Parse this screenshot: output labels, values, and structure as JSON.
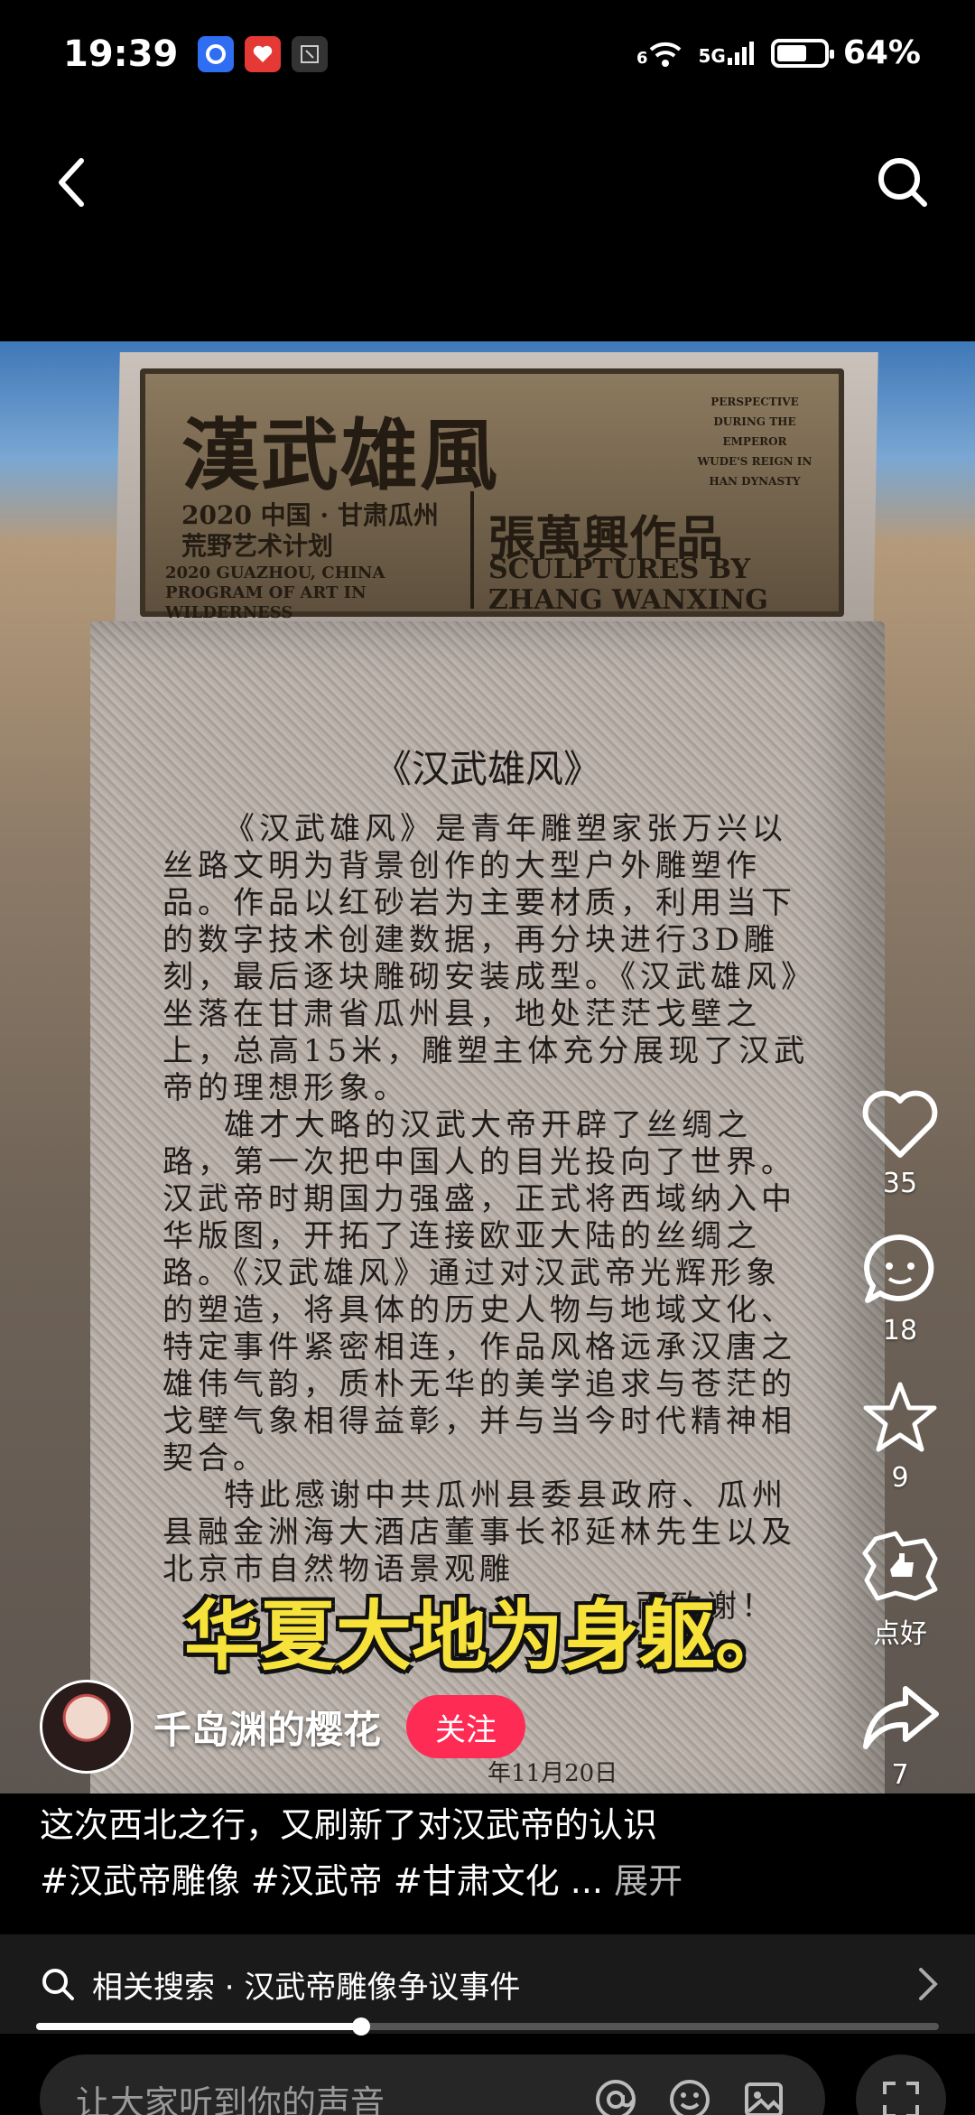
{
  "status_bar": {
    "time": "19:39",
    "network_left": "6",
    "network_right": "5G",
    "battery_percent": 64,
    "battery_label": "64%",
    "app_badges": [
      "app-badge-blue-icon",
      "app-badge-red-icon",
      "app-badge-gray-icon"
    ]
  },
  "nav": {
    "back_icon": "chevron-left-icon",
    "search_icon": "search-icon"
  },
  "media": {
    "plaque": {
      "title": "漢武雄風",
      "side_en": "PERSPECTIVE DURING THE EMPEROR WUDE'S REIGN IN HAN DYNASTY",
      "cn_left_line1": "2020 中国 · 甘肃瓜州",
      "cn_left_line2": "荒野艺术计划",
      "en_left": "2020 GUAZHOU, CHINA PROGRAM OF ART IN WILDERNESS",
      "cn_right": "張萬興作品",
      "en_right": "SCULPTURES BY ZHANG WANXING"
    },
    "stone_heading": "《汉武雄风》",
    "stone_paragraphs": [
      "《汉武雄风》是青年雕塑家张万兴以丝路文明为背景创作的大型户外雕塑作品。作品以红砂岩为主要材质，利用当下的数字技术创建数据，再分块进行3D雕刻，最后逐块雕砌安装成型。《汉武雄风》坐落在甘肃省瓜州县，地处茫茫戈壁之上，总高15米，雕塑主体充分展现了汉武帝的理想形象。",
      "雄才大略的汉武大帝开辟了丝绸之路，第一次把中国人的目光投向了世界。汉武帝时期国力强盛，正式将西域纳入中华版图，开拓了连接欧亚大陆的丝绸之路。《汉武雄风》通过对汉武帝光辉形象的塑造，将具体的历史人物与地域文化、特定事件紧密相连，作品风格远承汉唐之雄伟气韵，质朴无华的美学追求与苍茫的戈壁气象相得益彰，并与当今时代精神相契合。",
      "特此感谢中共瓜州县委县政府、瓜州县融金洲海大酒店董事长祁延林先生以及北京市自然物语景观雕"
    ],
    "stone_footer": "而致谢！",
    "stone_date": "年11月20日",
    "caption": "华夏大地为身躯。"
  },
  "author": {
    "name": "千岛渊的樱花",
    "follow_label": "关注"
  },
  "actions": [
    {
      "icon": "heart-icon",
      "count": "35"
    },
    {
      "icon": "comment-icon",
      "count": "18"
    },
    {
      "icon": "star-icon",
      "count": "9"
    },
    {
      "icon": "thumbs-up-icon",
      "count": "点好"
    },
    {
      "icon": "share-icon",
      "count": "7"
    }
  ],
  "description": {
    "text": "这次西北之行，又刷新了对汉武帝的认识",
    "hashtags": "#汉武帝雕像 #汉武帝 #甘肃文化 ...",
    "expand_label": "展开"
  },
  "related_search": {
    "icon": "search-icon",
    "text": "相关搜索 · 汉武帝雕像争议事件",
    "chevron": "chevron-right-icon"
  },
  "progress": {
    "fraction": 0.36
  },
  "comment_bar": {
    "placeholder": "让大家听到你的声音",
    "icons": [
      "at-icon",
      "emoji-icon",
      "image-icon"
    ],
    "fullscreen_icon": "fullscreen-icon"
  },
  "colors": {
    "follow_red": "#fe2c55",
    "caption_yellow": "#f6e23a",
    "bar_bg": "#1a1a1a"
  }
}
